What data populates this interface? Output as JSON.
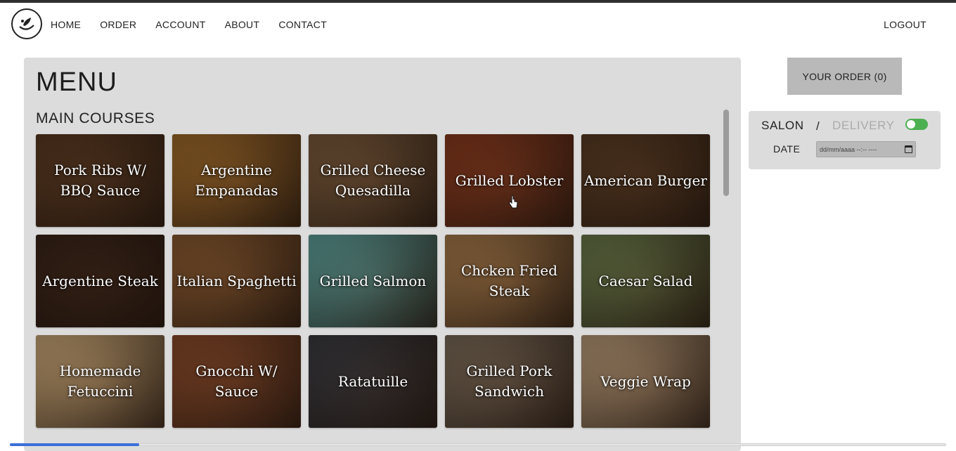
{
  "nav": {
    "items": [
      "HOME",
      "ORDER",
      "ACCOUNT",
      "ABOUT",
      "CONTACT"
    ],
    "logout": "LOGOUT"
  },
  "menu": {
    "title": "MENU",
    "section": "MAIN COURSES",
    "items": [
      {
        "name": "Pork Ribs W/ BBQ Sauce",
        "bg": "#5b3a22"
      },
      {
        "name": "Argentine Empanadas",
        "bg": "#a06a2a"
      },
      {
        "name": "Grilled Cheese Quesadilla",
        "bg": "#7a5a3c"
      },
      {
        "name": "Grilled Lobster",
        "bg": "#8a3a1e"
      },
      {
        "name": "American Burger",
        "bg": "#5a3c24"
      },
      {
        "name": "Argentine Steak",
        "bg": "#3a2418"
      },
      {
        "name": "Italian Spaghetti",
        "bg": "#8a5a30"
      },
      {
        "name": "Grilled Salmon",
        "bg": "#5e9f9a"
      },
      {
        "name": "Chcken Fried Steak",
        "bg": "#a67a4a"
      },
      {
        "name": "Caesar Salad",
        "bg": "#6a7a4a"
      },
      {
        "name": "Homemade Fetuccini",
        "bg": "#c9a676"
      },
      {
        "name": "Gnocchi W/ Sauce",
        "bg": "#8a4a2a"
      },
      {
        "name": "Ratatuille",
        "bg": "#3a3a40"
      },
      {
        "name": "Grilled Pork Sandwich",
        "bg": "#7a6a58"
      },
      {
        "name": "Veggie Wrap",
        "bg": "#b89a78"
      }
    ]
  },
  "order": {
    "button": "YOUR ORDER (0)",
    "salon": "SALON",
    "separator": "/",
    "delivery": "DELIVERY",
    "date_label": "DATE",
    "date_placeholder": "dd/mm/aaaa --:-- ----",
    "toggle_on": true,
    "toggle_color": "#4caf50"
  }
}
